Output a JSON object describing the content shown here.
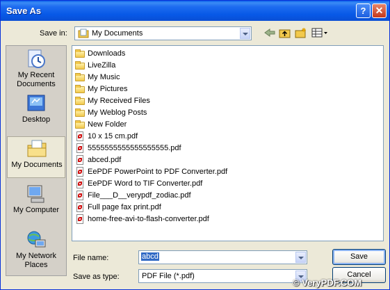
{
  "window": {
    "title": "Save As",
    "help_glyph": "?",
    "close_glyph": "✕"
  },
  "save_in": {
    "label": "Save in:",
    "value": "My Documents"
  },
  "places": [
    {
      "label": "My Recent Documents",
      "icon": "recent-documents-icon"
    },
    {
      "label": "Desktop",
      "icon": "desktop-icon"
    },
    {
      "label": "My Documents",
      "icon": "my-documents-icon",
      "selected": true
    },
    {
      "label": "My Computer",
      "icon": "my-computer-icon"
    },
    {
      "label": "My Network Places",
      "icon": "network-places-icon"
    }
  ],
  "files": [
    {
      "name": "Downloads",
      "type": "folder"
    },
    {
      "name": "LiveZilla",
      "type": "folder"
    },
    {
      "name": "My Music",
      "type": "folder"
    },
    {
      "name": "My Pictures",
      "type": "folder"
    },
    {
      "name": "My Received Files",
      "type": "folder"
    },
    {
      "name": "My Weblog Posts",
      "type": "folder"
    },
    {
      "name": "New Folder",
      "type": "folder"
    },
    {
      "name": "10 x 15 cm.pdf",
      "type": "pdf"
    },
    {
      "name": "5555555555555555555.pdf",
      "type": "pdf"
    },
    {
      "name": "abced.pdf",
      "type": "pdf"
    },
    {
      "name": "EePDF PowerPoint to PDF Converter.pdf",
      "type": "pdf"
    },
    {
      "name": "EePDF Word to TIF Converter.pdf",
      "type": "pdf"
    },
    {
      "name": "File___D__verypdf_zodiac.pdf",
      "type": "pdf"
    },
    {
      "name": "Full page fax print.pdf",
      "type": "pdf"
    },
    {
      "name": "home-free-avi-to-flash-converter.pdf",
      "type": "pdf"
    }
  ],
  "file_name": {
    "label": "File name:",
    "value": "abcd"
  },
  "save_as_type": {
    "label": "Save as type:",
    "value": "PDF File (*.pdf)"
  },
  "buttons": {
    "save": "Save",
    "cancel": "Cancel"
  },
  "watermark": "© VeryPDF.COM"
}
